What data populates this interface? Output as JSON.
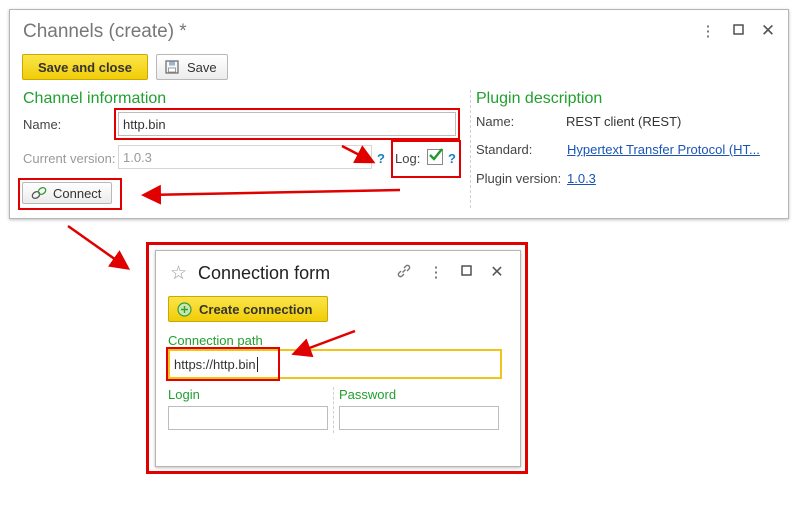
{
  "main_form": {
    "title": "Channels (create) *",
    "save_close_label": "Save and close",
    "save_label": "Save",
    "channel_section": "Channel information",
    "name_label": "Name:",
    "name_value": "http.bin",
    "version_label": "Current version:",
    "version_value": "1.0.3",
    "help_mark": "?",
    "log_label": "Log:",
    "log_checked": true,
    "connect_label": "Connect",
    "plugin_section": "Plugin description",
    "plugin_name_label": "Name:",
    "plugin_name_value": "REST client (REST)",
    "standard_label": "Standard:",
    "standard_value": "Hypertext Transfer Protocol (HT...",
    "plugin_version_label": "Plugin version:",
    "plugin_version_value": "1.0.3"
  },
  "connection_form": {
    "title": "Connection form",
    "create_label": "Create connection",
    "path_label": "Connection path",
    "path_value": "https://http.bin",
    "login_label": "Login",
    "login_value": "",
    "password_label": "Password",
    "password_value": ""
  },
  "colors": {
    "annotation": "#e00000",
    "accent_green": "#21a02f",
    "button_yellow": "#f5d619",
    "link_blue": "#1a55b4"
  },
  "icons": [
    "more-icon",
    "maximize-icon",
    "close-icon",
    "save-disk-icon",
    "connect-link-icon",
    "star-icon",
    "link-icon",
    "plus-circle-icon",
    "checkbox-check-icon"
  ]
}
